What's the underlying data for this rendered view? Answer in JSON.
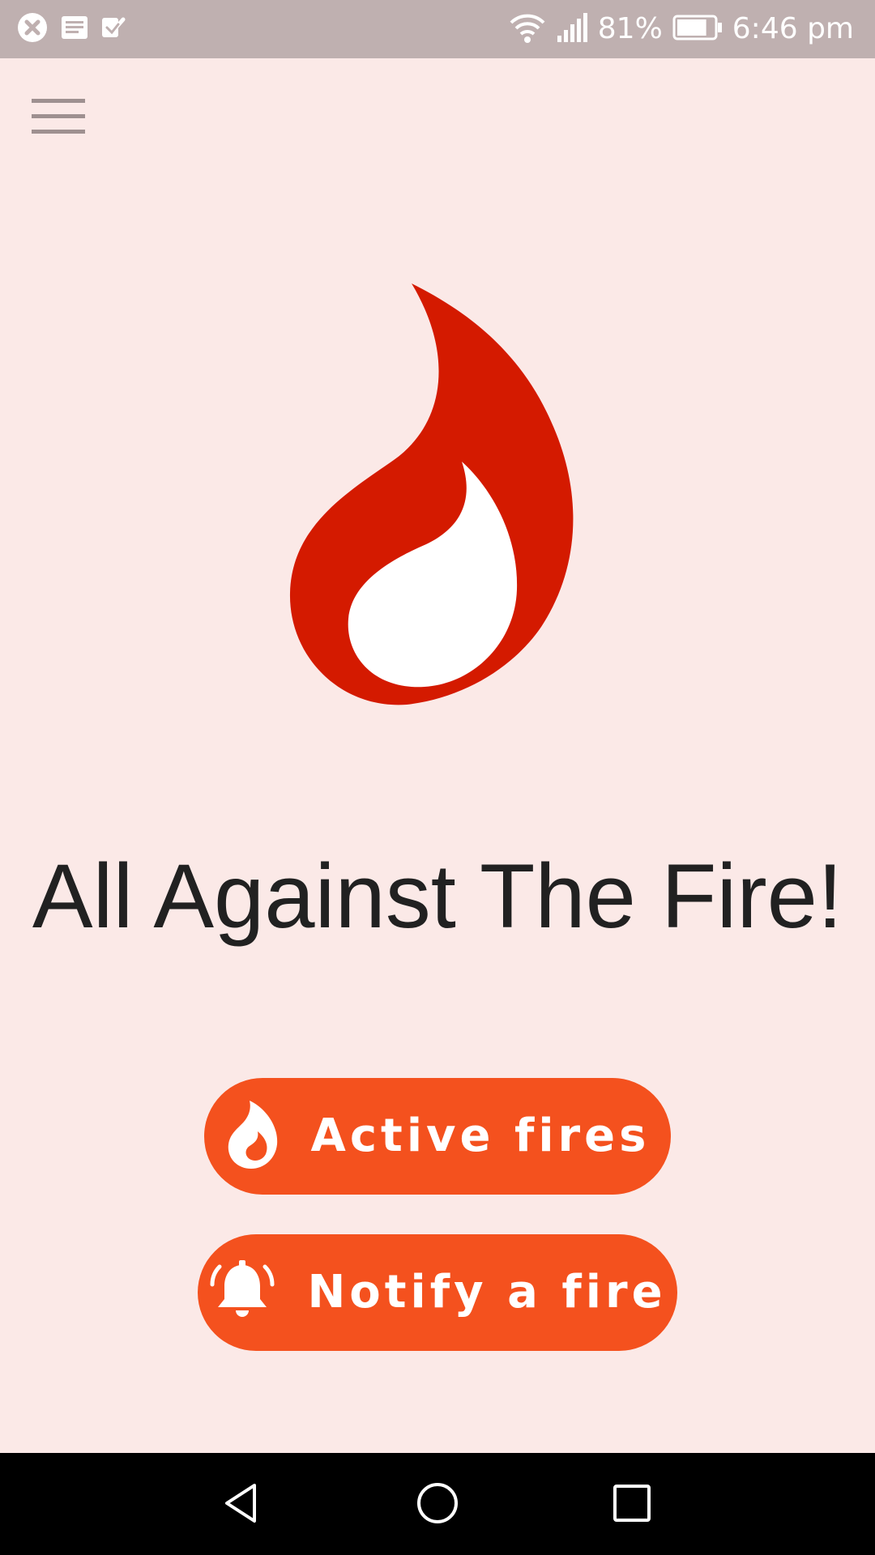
{
  "status_bar": {
    "notification_icons": [
      "close-circle-icon",
      "news-icon",
      "checklist-icon"
    ],
    "system_icons": [
      "wifi-icon",
      "signal-icon"
    ],
    "battery_percent": "81%",
    "battery_level": 0.81,
    "time": "6:46 pm"
  },
  "app_bar": {
    "menu_icon": "hamburger-menu-icon"
  },
  "main": {
    "logo_icon": "flame-logo-icon",
    "title": "All Against The Fire!",
    "buttons": [
      {
        "label": "Active fires",
        "icon": "flame-icon"
      },
      {
        "label": "Notify a fire",
        "icon": "alarm-bell-icon"
      }
    ]
  },
  "nav_bar": {
    "icons": [
      "back-icon",
      "home-icon",
      "recents-icon"
    ]
  },
  "colors": {
    "background": "#fbe9e7",
    "status_bar": "#bfb0b0",
    "accent_button": "#f4511e",
    "logo_red": "#d41a00",
    "title_text": "#212121"
  }
}
